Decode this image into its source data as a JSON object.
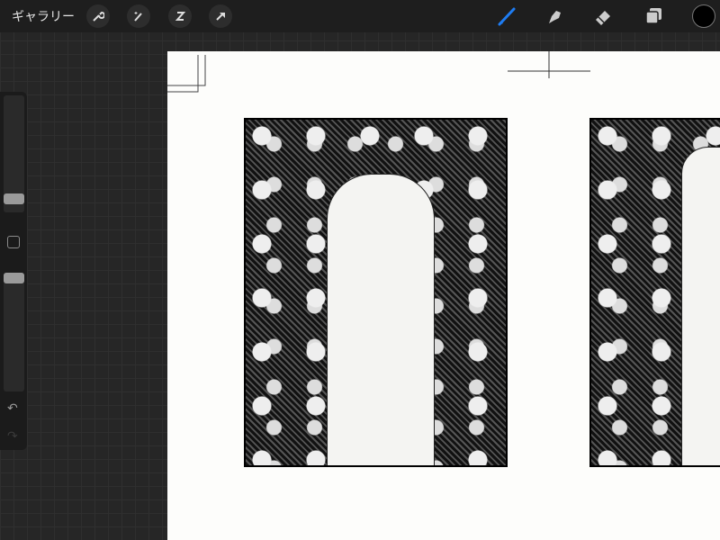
{
  "topbar": {
    "gallery_label": "ギャラリー",
    "left_tools": [
      "wrench-icon",
      "magic-wand-icon",
      "selection-icon",
      "transform-arrow-icon"
    ],
    "right_tools": [
      "brush-icon",
      "smudge-icon",
      "eraser-icon",
      "layers-icon"
    ],
    "active_tool": "brush",
    "accent_color": "#1e7cf2",
    "current_color": "#000000"
  },
  "sidebar": {
    "brush_size_level": 0.14,
    "opacity_level": 0.93
  }
}
